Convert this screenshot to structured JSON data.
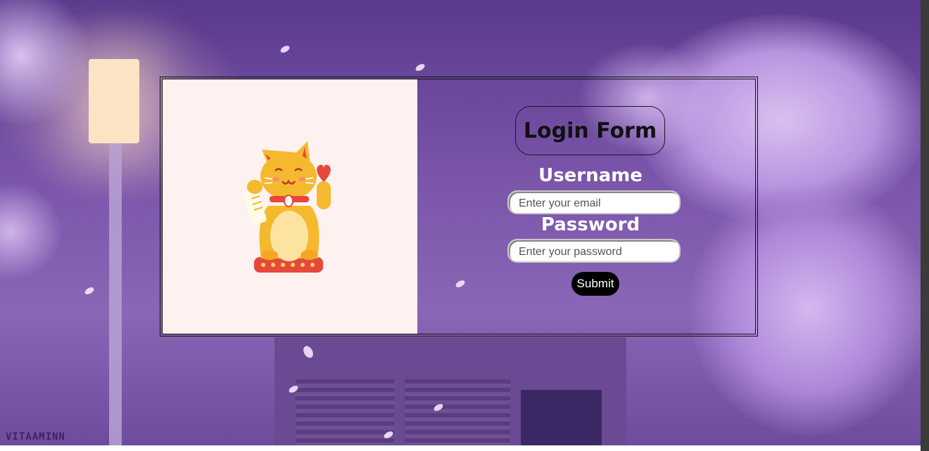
{
  "form": {
    "title": "Login Form",
    "username_label": "Username",
    "username_placeholder": "Enter your email",
    "password_label": "Password",
    "password_placeholder": "Enter your password",
    "submit_label": "Submit"
  },
  "image": {
    "icon": "maneki-neko-cat-icon"
  },
  "watermark": "VITAAMINN",
  "colors": {
    "background": "#7a55aa",
    "image_panel": "#fdf2f0",
    "submit_bg": "#000000",
    "label_text": "#ffffff"
  }
}
